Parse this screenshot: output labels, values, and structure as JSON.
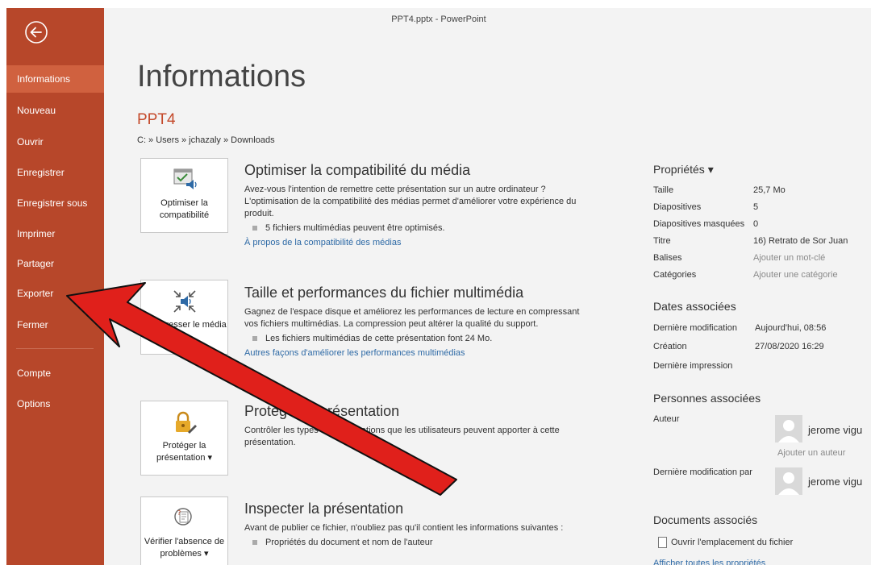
{
  "window": {
    "title": "PPT4.pptx - PowerPoint"
  },
  "sidebar": {
    "items": [
      {
        "label": "Informations",
        "active": true
      },
      {
        "label": "Nouveau"
      },
      {
        "label": "Ouvrir"
      },
      {
        "label": "Enregistrer"
      },
      {
        "label": "Enregistrer sous"
      },
      {
        "label": "Imprimer"
      },
      {
        "label": "Partager"
      },
      {
        "label": "Exporter"
      },
      {
        "label": "Fermer"
      },
      {
        "label": "Compte"
      },
      {
        "label": "Options"
      }
    ]
  },
  "main": {
    "title": "Informations",
    "doc_name": "PPT4",
    "path": "C: » Users » jchazaly » Downloads",
    "sections": [
      {
        "tile_label": "Optimiser la compatibilité",
        "heading": "Optimiser la compatibilité du média",
        "text": "Avez-vous l'intention de remettre cette présentation sur un autre ordinateur ? L'optimisation de la compatibilité des médias permet d'améliorer votre expérience du produit.",
        "bullet": "5 fichiers multimédias peuvent être optimisés.",
        "link": "À propos de la compatibilité des médias"
      },
      {
        "tile_label": "Compresser le média ▾",
        "heading": "Taille et performances du fichier multimédia",
        "text": "Gagnez de l'espace disque et améliorez les performances de lecture en compressant vos fichiers multimédias. La compression peut altérer la qualité du support.",
        "bullet": "Les fichiers multimédias de cette présentation font 24 Mo.",
        "link": "Autres façons d'améliorer les performances multimédias"
      },
      {
        "tile_label": "Protéger la présentation ▾",
        "heading": "Protéger la présentation",
        "text": "Contrôler les types de modifications que les utilisateurs peuvent apporter à cette présentation."
      },
      {
        "tile_label": "Vérifier l'absence de problèmes ▾",
        "heading": "Inspecter la présentation",
        "text": "Avant de publier ce fichier, n'oubliez pas qu'il contient les informations suivantes :",
        "bullet": "Propriétés du document et nom de l'auteur"
      }
    ]
  },
  "properties": {
    "heading": "Propriétés ▾",
    "rows": [
      {
        "label": "Taille",
        "value": "25,7 Mo"
      },
      {
        "label": "Diapositives",
        "value": "5"
      },
      {
        "label": "Diapositives masquées",
        "value": "0"
      },
      {
        "label": "Titre",
        "value": "16) Retrato de Sor Juan"
      },
      {
        "label": "Balises",
        "value": "Ajouter un mot-clé"
      },
      {
        "label": "Catégories",
        "value": "Ajouter une catégorie"
      }
    ]
  },
  "dates": {
    "heading": "Dates associées",
    "rows": [
      {
        "label": "Dernière modification",
        "value": "Aujourd'hui, 08:56"
      },
      {
        "label": "Création",
        "value": "27/08/2020 16:29"
      },
      {
        "label": "Dernière impression",
        "value": ""
      }
    ]
  },
  "people": {
    "heading": "Personnes associées",
    "author_label": "Auteur",
    "author_name": "jerome vigu",
    "add_author": "Ajouter un auteur",
    "last_modified_label": "Dernière modification par",
    "last_modified_name": "jerome vigu"
  },
  "documents": {
    "heading": "Documents associés",
    "open_location": "Ouvrir l'emplacement du fichier",
    "show_all": "Afficher toutes les propriétés"
  },
  "colors": {
    "sidebar": "#b7472a",
    "sidebar_active": "#d0613f",
    "accent": "#c4492a",
    "link": "#2e6aa6",
    "arrow": "#e0201b"
  }
}
